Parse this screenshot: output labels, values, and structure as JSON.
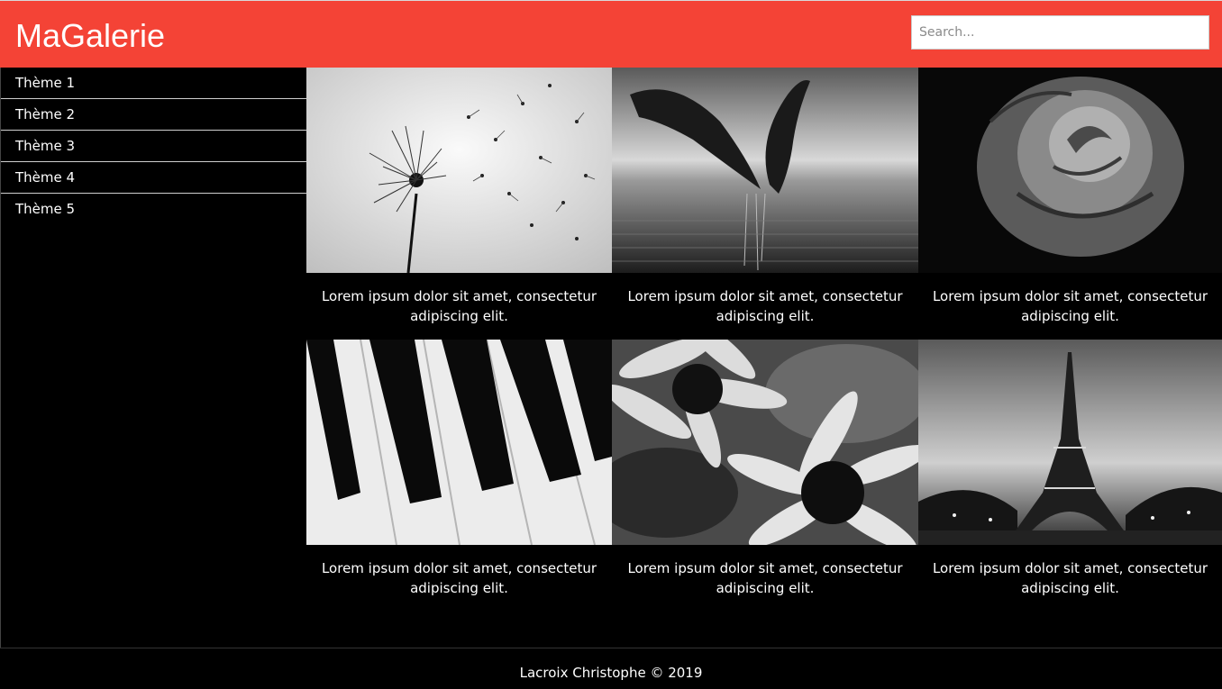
{
  "header": {
    "title": "MaGalerie",
    "search_placeholder": "Search...",
    "accent_color": "#f44336"
  },
  "sidebar": {
    "items": [
      {
        "label": "Thème 1"
      },
      {
        "label": "Thème 2"
      },
      {
        "label": "Thème 3"
      },
      {
        "label": "Thème 4"
      },
      {
        "label": "Thème 5"
      }
    ]
  },
  "gallery": {
    "items": [
      {
        "image": "dandelion-photo",
        "caption": "Lorem ipsum dolor sit amet, consectetur adipiscing elit."
      },
      {
        "image": "dolphins-photo",
        "caption": "Lorem ipsum dolor sit amet, consectetur adipiscing elit."
      },
      {
        "image": "rose-photo",
        "caption": "Lorem ipsum dolor sit amet, consectetur adipiscing elit."
      },
      {
        "image": "piano-keys-photo",
        "caption": "Lorem ipsum dolor sit amet, consectetur adipiscing elit."
      },
      {
        "image": "daisies-photo",
        "caption": "Lorem ipsum dolor sit amet, consectetur adipiscing elit."
      },
      {
        "image": "eiffel-tower-photo",
        "caption": "Lorem ipsum dolor sit amet, consectetur adipiscing elit."
      }
    ]
  },
  "footer": {
    "text": "Lacroix Christophe © 2019"
  }
}
